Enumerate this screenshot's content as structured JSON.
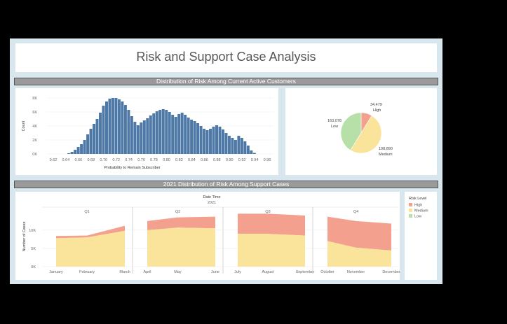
{
  "dashboard": {
    "title": "Risk and Support Case Analysis",
    "band1": "Distribution of Risk Among Current Active Customers",
    "band2": "2021 Distribution of Risk Among Support Cases"
  },
  "histogram": {
    "xlabel": "Probability to Remain Subscriber",
    "ylabel": "Count",
    "yticks": [
      "8K",
      "6K",
      "4K",
      "2K",
      "0K"
    ],
    "xticks": [
      "0.62",
      "0.64",
      "0.66",
      "0.68",
      "0.70",
      "0.72",
      "0.74",
      "0.76",
      "0.78",
      "0.80",
      "0.82",
      "0.84",
      "0.86",
      "0.88",
      "0.90",
      "0.92",
      "0.94",
      "0.96"
    ]
  },
  "pie": {
    "slices": [
      {
        "label": "High",
        "value": "34,479",
        "color": "#f4a08f"
      },
      {
        "label": "Medium",
        "value": "198,890",
        "color": "#fae39a"
      },
      {
        "label": "Low",
        "value": "163,078",
        "color": "#b7e0a8"
      }
    ]
  },
  "area": {
    "header": "Date Time",
    "year": "2021",
    "ylabel": "Number of Cases",
    "yticks": [
      "10K",
      "5K",
      "0K"
    ],
    "quarters": [
      {
        "label": "Q1",
        "months": [
          "January",
          "February",
          "March"
        ]
      },
      {
        "label": "Q2",
        "months": [
          "April",
          "May",
          "June"
        ]
      },
      {
        "label": "Q3",
        "months": [
          "July",
          "August",
          "September"
        ]
      },
      {
        "label": "Q4",
        "months": [
          "October",
          "November",
          "December"
        ]
      }
    ]
  },
  "legend": {
    "title": "Risk Level",
    "items": [
      {
        "label": "High",
        "color": "#f4a08f"
      },
      {
        "label": "Medium",
        "color": "#fae39a"
      },
      {
        "label": "Low",
        "color": "#b7e0a8"
      }
    ]
  },
  "chart_data": [
    {
      "type": "bar",
      "xlabel": "Probability to Remain Subscriber",
      "ylabel": "Count",
      "xlim": [
        0.61,
        0.97
      ],
      "ylim": [
        0,
        8000
      ],
      "x": [
        0.645,
        0.65,
        0.655,
        0.66,
        0.665,
        0.67,
        0.675,
        0.68,
        0.685,
        0.69,
        0.695,
        0.7,
        0.705,
        0.71,
        0.715,
        0.72,
        0.725,
        0.73,
        0.735,
        0.74,
        0.745,
        0.75,
        0.755,
        0.76,
        0.765,
        0.77,
        0.775,
        0.78,
        0.785,
        0.79,
        0.795,
        0.8,
        0.805,
        0.81,
        0.815,
        0.82,
        0.825,
        0.83,
        0.835,
        0.84,
        0.845,
        0.85,
        0.855,
        0.86,
        0.865,
        0.87,
        0.875,
        0.88,
        0.885,
        0.89,
        0.895,
        0.9,
        0.905,
        0.91,
        0.915,
        0.92,
        0.925,
        0.93,
        0.935,
        0.94
      ],
      "values": [
        100,
        300,
        600,
        1000,
        1400,
        2000,
        2800,
        3600,
        4300,
        5000,
        5900,
        6900,
        7500,
        7900,
        8000,
        8000,
        7800,
        7500,
        7000,
        6300,
        5400,
        4600,
        4100,
        4500,
        4800,
        5100,
        5500,
        5800,
        6100,
        6300,
        6400,
        6300,
        6000,
        5600,
        5300,
        5700,
        5900,
        5600,
        5200,
        4900,
        4700,
        4400,
        4000,
        3600,
        3400,
        3600,
        3900,
        4100,
        3900,
        3500,
        3000,
        2600,
        2300,
        2000,
        2600,
        2300,
        1800,
        1200,
        500,
        150
      ]
    },
    {
      "type": "pie",
      "categories": [
        "High",
        "Medium",
        "Low"
      ],
      "values": [
        34479,
        198890,
        163078
      ]
    },
    {
      "type": "area",
      "categories": [
        "January",
        "February",
        "March",
        "April",
        "May",
        "June",
        "July",
        "August",
        "September",
        "October",
        "November",
        "December"
      ],
      "ylabel": "Number of Cases",
      "ylim": [
        0,
        14000
      ],
      "series": [
        {
          "name": "Medium",
          "values": [
            7800,
            8000,
            9800,
            10000,
            10700,
            10500,
            9000,
            9000,
            8500,
            7000,
            5200,
            4400
          ]
        },
        {
          "name": "High",
          "values": [
            8400,
            8500,
            11200,
            12500,
            13500,
            13700,
            14500,
            14500,
            14000,
            13700,
            12500,
            11800
          ]
        }
      ]
    }
  ]
}
